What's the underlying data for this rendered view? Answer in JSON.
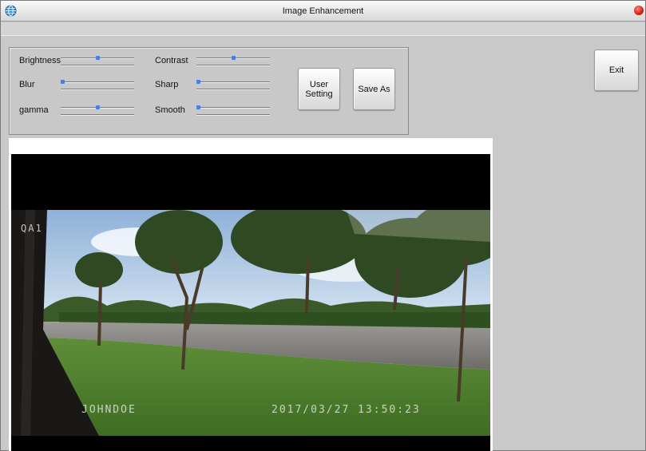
{
  "window": {
    "title": "Image Enhancement"
  },
  "controls": {
    "sliders_left": [
      {
        "label": "Brightness",
        "value": 0.5
      },
      {
        "label": "Blur",
        "value": 0.0
      },
      {
        "label": "gamma",
        "value": 0.5
      }
    ],
    "sliders_right": [
      {
        "label": "Contrast",
        "value": 0.5
      },
      {
        "label": "Sharp",
        "value": 0.0
      },
      {
        "label": "Smooth",
        "value": 0.0
      }
    ],
    "user_setting_label": "User\nSetting",
    "save_as_label": "Save As"
  },
  "exit_label": "Exit",
  "video": {
    "camera_label": "QA1",
    "user_label": "JOHNDOE",
    "timestamp": "2017/03/27 13:50:23"
  },
  "colors": {
    "slider_thumb": "#4e7fd8",
    "close_button": "#d21f12"
  },
  "icons": {
    "app": "globe-icon",
    "close": "close-icon"
  }
}
